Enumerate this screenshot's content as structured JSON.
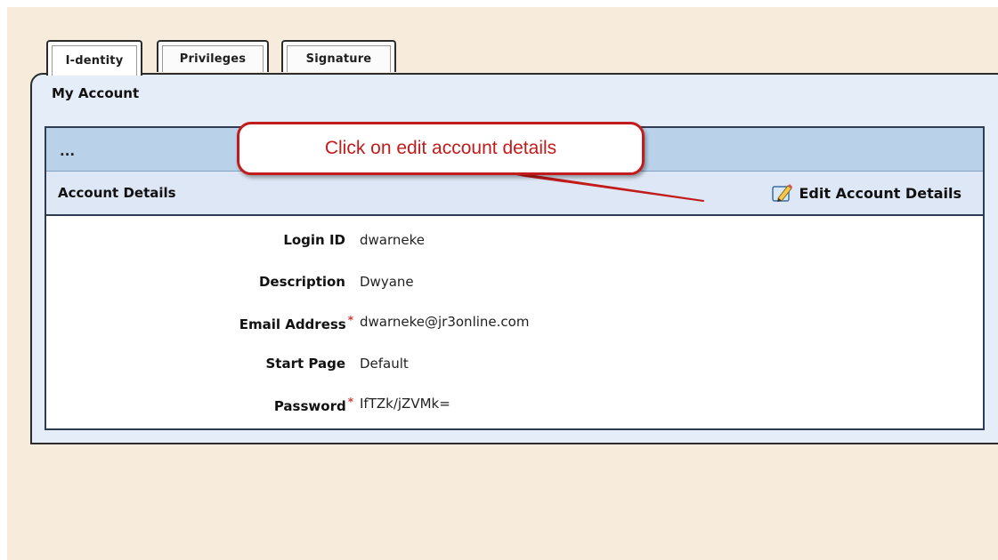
{
  "tabs": [
    {
      "label": "I-dentity",
      "active": true
    },
    {
      "label": "Privileges",
      "active": false
    },
    {
      "label": "Signature",
      "active": false
    }
  ],
  "panel": {
    "title": "My Account",
    "collapsed_bar": "...",
    "section_title": "Account Details",
    "edit_label": "Edit Account Details"
  },
  "fields": [
    {
      "label": "Login ID",
      "value": "dwarneke",
      "required": false
    },
    {
      "label": "Description",
      "value": "Dwyane",
      "required": false
    },
    {
      "label": "Email Address",
      "value": "dwarneke@jr3online.com",
      "required": true
    },
    {
      "label": "Start Page",
      "value": "Default",
      "required": false
    },
    {
      "label": "Password",
      "value": "IfTZk/jZVMk=",
      "required": true
    }
  ],
  "required_marker": "*",
  "callout": {
    "text": "Click on edit account details"
  },
  "colors": {
    "page_background": "#f7ecdc",
    "panel_background": "#e5edf9",
    "header_bar": "#b9d2ea",
    "callout_accent": "#c21b1b",
    "required_marker": "#d23a3a"
  },
  "icons": {
    "edit": "edit-pencil-icon"
  }
}
